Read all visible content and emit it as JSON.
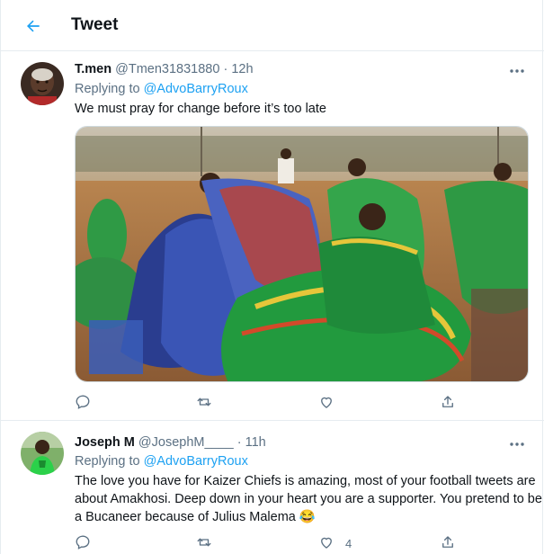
{
  "header": {
    "title": "Tweet"
  },
  "tweets": [
    {
      "name": "T.men",
      "handle": "@Tmen31831880",
      "separator": "·",
      "time": "12h",
      "replying_prefix": "Replying to ",
      "replying_to": "@AdvoBarryRoux",
      "text": "We must pray for change before it’s too late",
      "counts": {
        "reply": "",
        "retweet": "",
        "like": "",
        "share": ""
      }
    },
    {
      "name": "Joseph M",
      "handle": "@JosephM____",
      "separator": "·",
      "time": "11h",
      "replying_prefix": "Replying to ",
      "replying_to": "@AdvoBarryRoux",
      "text": "The love you have for Kaizer Chiefs is amazing, most of your football tweets are about Amakhosi. Deep down in your heart you are a supporter. You pretend to be a Bucaneer because of Julius Malema 😂",
      "counts": {
        "reply": "",
        "retweet": "",
        "like": "4",
        "share": ""
      }
    }
  ],
  "colors": {
    "accent": "#1da1f2",
    "muted": "#5b7083",
    "border": "#e6ecf0",
    "text": "#0f1419"
  },
  "icons": [
    "back-arrow-icon",
    "more-icon",
    "reply-icon",
    "retweet-icon",
    "like-icon",
    "share-icon"
  ]
}
